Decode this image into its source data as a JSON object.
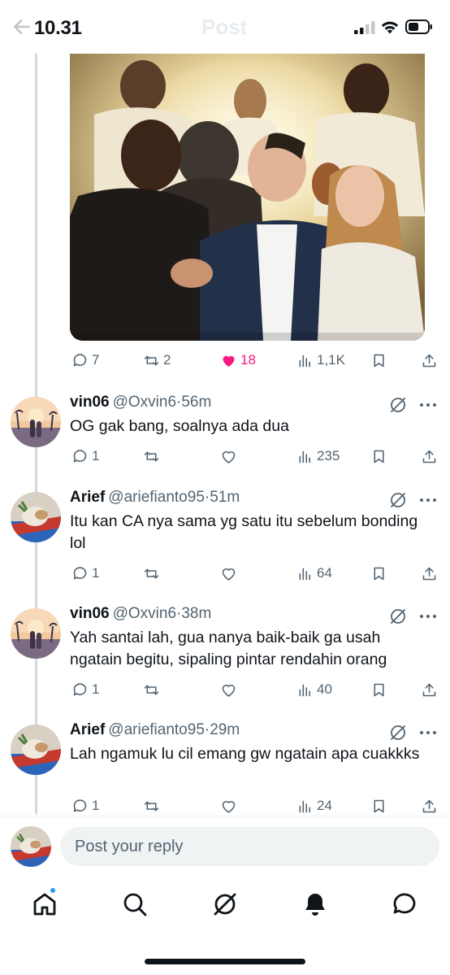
{
  "status_bar": {
    "time": "10.31",
    "faded_title": "Post"
  },
  "main_tweet": {
    "image_alt": "Generated image of people embracing under heavenly light",
    "actions": {
      "replies": "7",
      "reposts": "2",
      "likes": "18",
      "views": "1,1K"
    }
  },
  "replies": [
    {
      "name": "vin06",
      "handle": "@Oxvin6",
      "time": "56m",
      "text": "OG gak bang, soalnya ada dua",
      "actions": {
        "replies": "1",
        "reposts": "",
        "likes": "",
        "views": "235"
      }
    },
    {
      "name": "Arief",
      "handle": "@ariefianto95",
      "time": "51m",
      "text": "Itu kan CA nya sama yg satu itu sebelum bonding lol",
      "actions": {
        "replies": "1",
        "reposts": "",
        "likes": "",
        "views": "64"
      }
    },
    {
      "name": "vin06",
      "handle": "@Oxvin6",
      "time": "38m",
      "text": "Yah santai lah, gua nanya baik-baik ga usah ngatain begitu, sipaling pintar rendahin orang",
      "actions": {
        "replies": "1",
        "reposts": "",
        "likes": "",
        "views": "40"
      }
    },
    {
      "name": "Arief",
      "handle": "@ariefianto95",
      "time": "29m",
      "text": "Lah ngamuk lu cil emang gw ngatain apa cuakkks",
      "actions": {
        "replies": "1",
        "reposts": "",
        "likes": "",
        "views": "24"
      }
    }
  ],
  "composer": {
    "placeholder": "Post your reply"
  },
  "nav": {
    "items": [
      "home-icon",
      "search-icon",
      "grok-icon",
      "notifications-icon",
      "messages-icon"
    ]
  },
  "colors": {
    "accent": "#1d9bf0",
    "like": "#f91880",
    "muted": "#536471",
    "thread_line": "#cfd9de"
  }
}
